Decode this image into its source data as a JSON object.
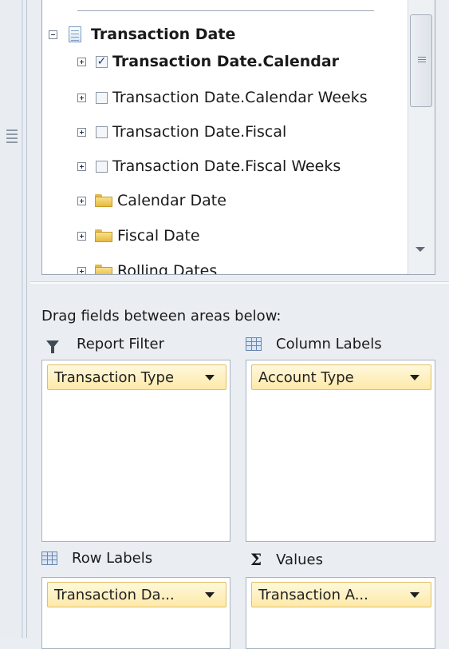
{
  "tree": {
    "group": {
      "label": "Transaction Date",
      "expander": "minus",
      "icon": "dimension-table-icon"
    },
    "hierarchies": [
      {
        "label": "Transaction Date.Calendar",
        "checked": true,
        "bold": true,
        "check_glyph": "✓"
      },
      {
        "label": "Transaction Date.Calendar Weeks",
        "checked": false,
        "check_glyph": ""
      },
      {
        "label": "Transaction Date.Fiscal",
        "checked": false,
        "check_glyph": ""
      },
      {
        "label": "Transaction Date.Fiscal Weeks",
        "checked": false,
        "check_glyph": ""
      }
    ],
    "folders": [
      {
        "label": "Calendar Date",
        "icon": "folder-icon"
      },
      {
        "label": "Fiscal Date",
        "icon": "folder-icon"
      },
      {
        "label": "Rolling Dates",
        "icon": "folder-icon"
      }
    ]
  },
  "areas": {
    "instructions": "Drag fields between areas below:",
    "report_filter": {
      "title": "Report Filter",
      "icon": "filter-icon",
      "field": "Transaction Type"
    },
    "column_labels": {
      "title": "Column Labels",
      "icon": "grid-icon",
      "field": "Account Type"
    },
    "row_labels": {
      "title": "Row Labels",
      "icon": "grid-icon",
      "field": "Transaction Da..."
    },
    "values": {
      "title": "Values",
      "icon": "sigma-icon",
      "glyph": "Σ",
      "field": "Transaction A..."
    }
  },
  "colors": {
    "panel_bg": "#eaeef3",
    "chip_fill": "#fde9a8",
    "chip_border": "#e2c067",
    "check_color": "#1d3c7a"
  }
}
